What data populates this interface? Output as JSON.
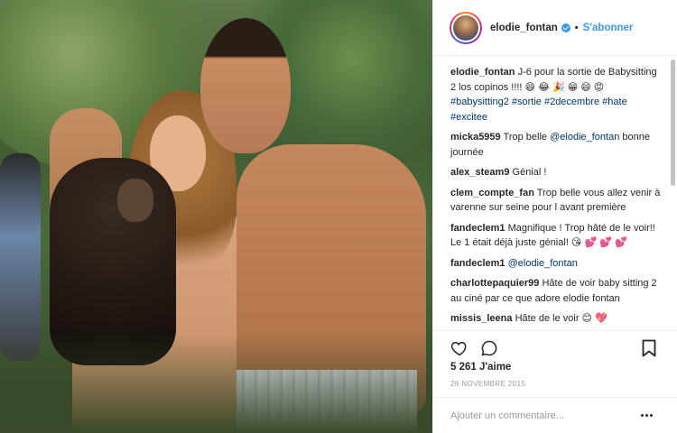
{
  "post": {
    "username": "elodie_fontan",
    "follow_label": "S'abonner",
    "caption": {
      "user": "elodie_fontan",
      "text": "J-6 pour la sortie de Babysitting 2 los copinos !!!! 😄 😂 🎉 😁 😄 😡",
      "hashtags": "#babysitting2 #sortie #2decembre #hate #excitee"
    },
    "comments": [
      {
        "user": "micka5959",
        "text": "Trop belle",
        "mention": "@elodie_fontan",
        "after": "bonne journée"
      },
      {
        "user": "alex_steam9",
        "text": "Génial !"
      },
      {
        "user": "clem_compte_fan",
        "text": "Trop belle vous allez venir à varenne sur seine pour l avant première"
      },
      {
        "user": "fandeclem1",
        "text": "Magnifique ! Trop hâté de le voir!! Le 1 était déjà juste génial! 😘 💕 💕 💕"
      },
      {
        "user": "fandeclem1",
        "mention": "@elodie_fontan"
      },
      {
        "user": "charlottepaquier99",
        "text": "Hâte de voir baby sitting 2 au ciné par ce que adore elodie fontan"
      },
      {
        "user": "missis_leena",
        "text": "Hâte de le voir 😊 💖"
      }
    ],
    "likes": "5 261 J'aime",
    "date": "26 NOVEMBRE 2015",
    "add_comment_placeholder": "Ajouter un commentaire...",
    "icons": [
      "heart-icon",
      "comment-icon",
      "bookmark-icon",
      "more-options-icon",
      "verified-icon"
    ]
  }
}
